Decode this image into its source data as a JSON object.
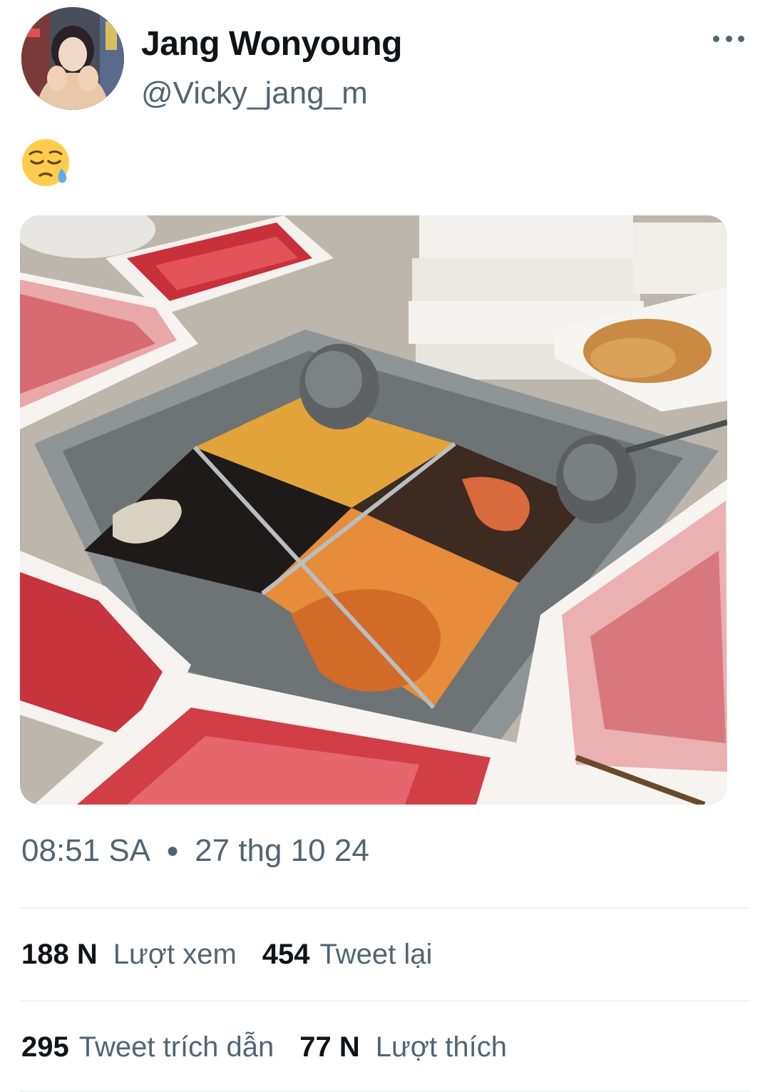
{
  "author": {
    "display_name": "Jang Wonyoung",
    "handle": "@Vicky_jang_m"
  },
  "tweet": {
    "text": "😪",
    "time": "08:51 SA",
    "date": "27 thg 10 24"
  },
  "stats": {
    "views_count": "188 N",
    "views_label": "Lượt xem",
    "retweets_count": "454",
    "retweets_label": "Tweet lại",
    "quotes_count": "295",
    "quotes_label": "Tweet trích dẫn",
    "likes_count": "77 N",
    "likes_label": "Lượt thích"
  },
  "icons": {
    "more": "more-options-icon"
  },
  "colors": {
    "text_primary": "#0f1419",
    "text_secondary": "#536471",
    "divider": "#eff3f4"
  }
}
